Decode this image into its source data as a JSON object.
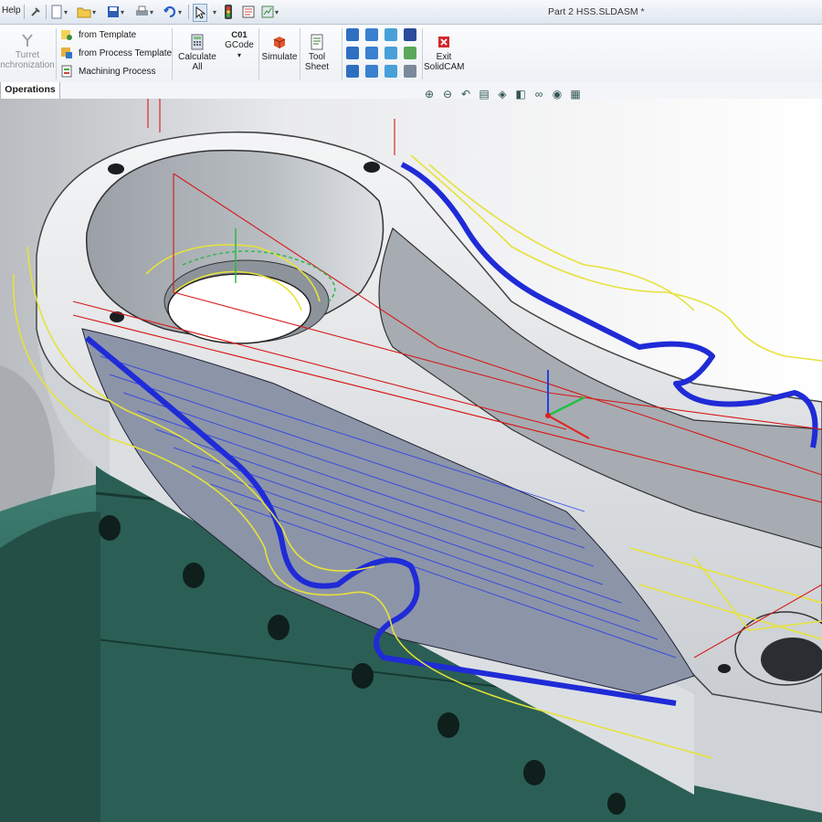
{
  "window": {
    "document_title": "Part 2 HSS.SLDASM *"
  },
  "menu": {
    "help_label": "Help"
  },
  "ribbon": {
    "turret_sync": {
      "line1": "Turret",
      "line2": "nchronization"
    },
    "from_template": "from Template",
    "from_process_template": "from Process Template",
    "machining_process": "Machining Process",
    "calculate_all": {
      "line1": "Calculate",
      "line2": "All"
    },
    "gcode": {
      "badge": "C01",
      "label": "GCode"
    },
    "simulate": "Simulate",
    "tool_sheet": {
      "line1": "Tool",
      "line2": "Sheet"
    },
    "exit": {
      "line1": "Exit",
      "line2": "SolidCAM"
    }
  },
  "tabs": {
    "operations": "Operations"
  },
  "colors": {
    "toolpath_blue": "#1f2bd6",
    "toolpath_yellow": "#e6e23a",
    "fixture_green": "#2e6a5e",
    "part_gray": "#a4a9af",
    "axis_red": "#d61a1a"
  }
}
